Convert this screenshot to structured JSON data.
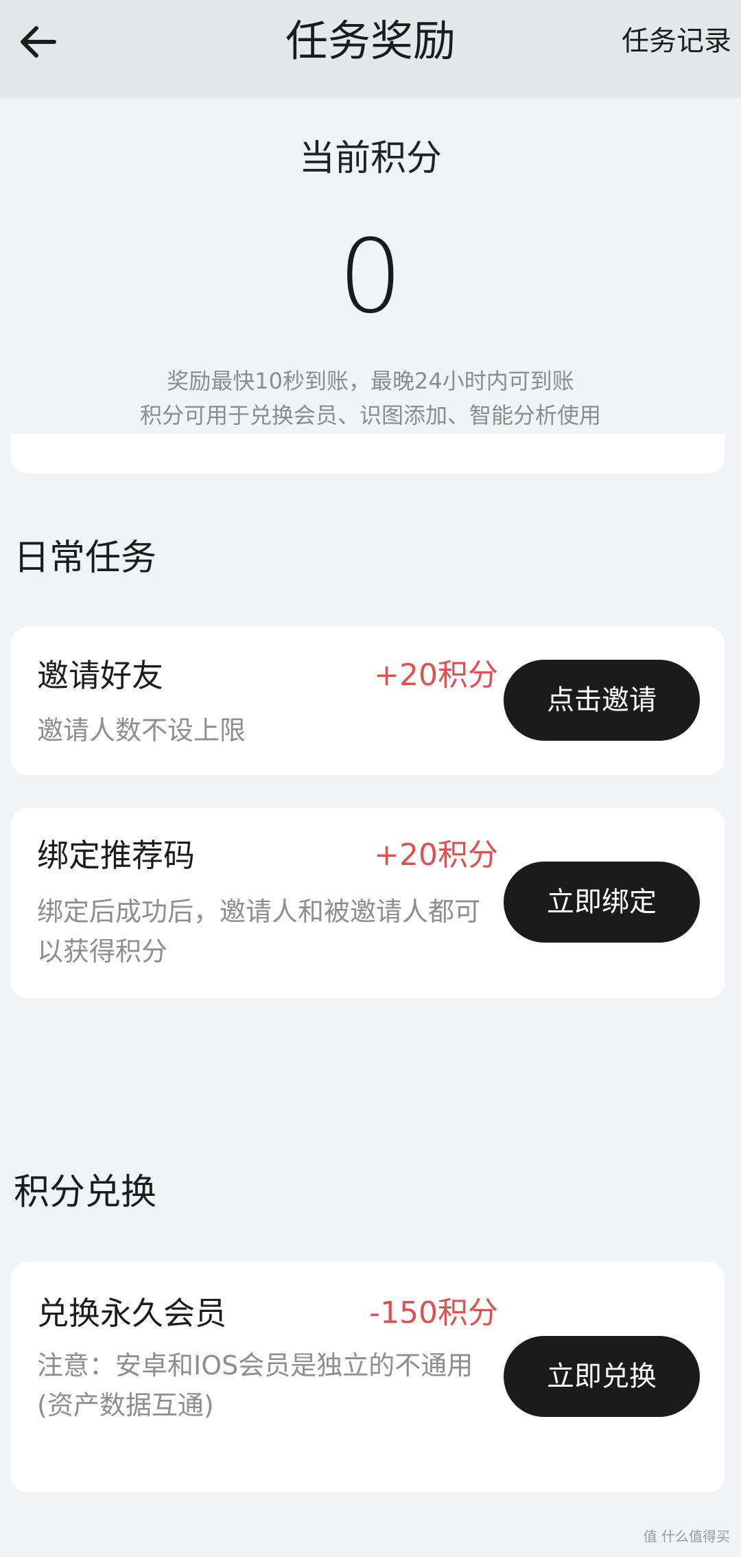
{
  "header": {
    "title": "任务奖励",
    "record_link": "任务记录"
  },
  "points": {
    "label": "当前积分",
    "value": "0",
    "note_1": "奖励最快10秒到账，最晚24小时内可到账",
    "note_2": "积分可用于兑换会员、识图添加、智能分析使用"
  },
  "daily": {
    "section_title": "日常任务",
    "tasks": [
      {
        "name": "邀请好友",
        "points": "+20积分",
        "desc": "邀请人数不设上限",
        "button": "点击邀请"
      },
      {
        "name": "绑定推荐码",
        "points": "+20积分",
        "desc": "绑定后成功后，邀请人和被邀请人都可以获得积分",
        "button": "立即绑定"
      }
    ]
  },
  "exchange": {
    "section_title": "积分兑换",
    "items": [
      {
        "name": "兑换永久会员",
        "points": "-150积分",
        "desc_1": "注意：安卓和IOS会员是独立的不通用",
        "desc_2": "(资产数据互通)",
        "button": "立即兑换"
      }
    ]
  },
  "watermark": "值 什么值得买",
  "colors": {
    "header_bg": "#e3e9ea",
    "page_bg": "#f1f3f5",
    "points_red": "#e05050",
    "button_bg": "#1b1b1b"
  }
}
